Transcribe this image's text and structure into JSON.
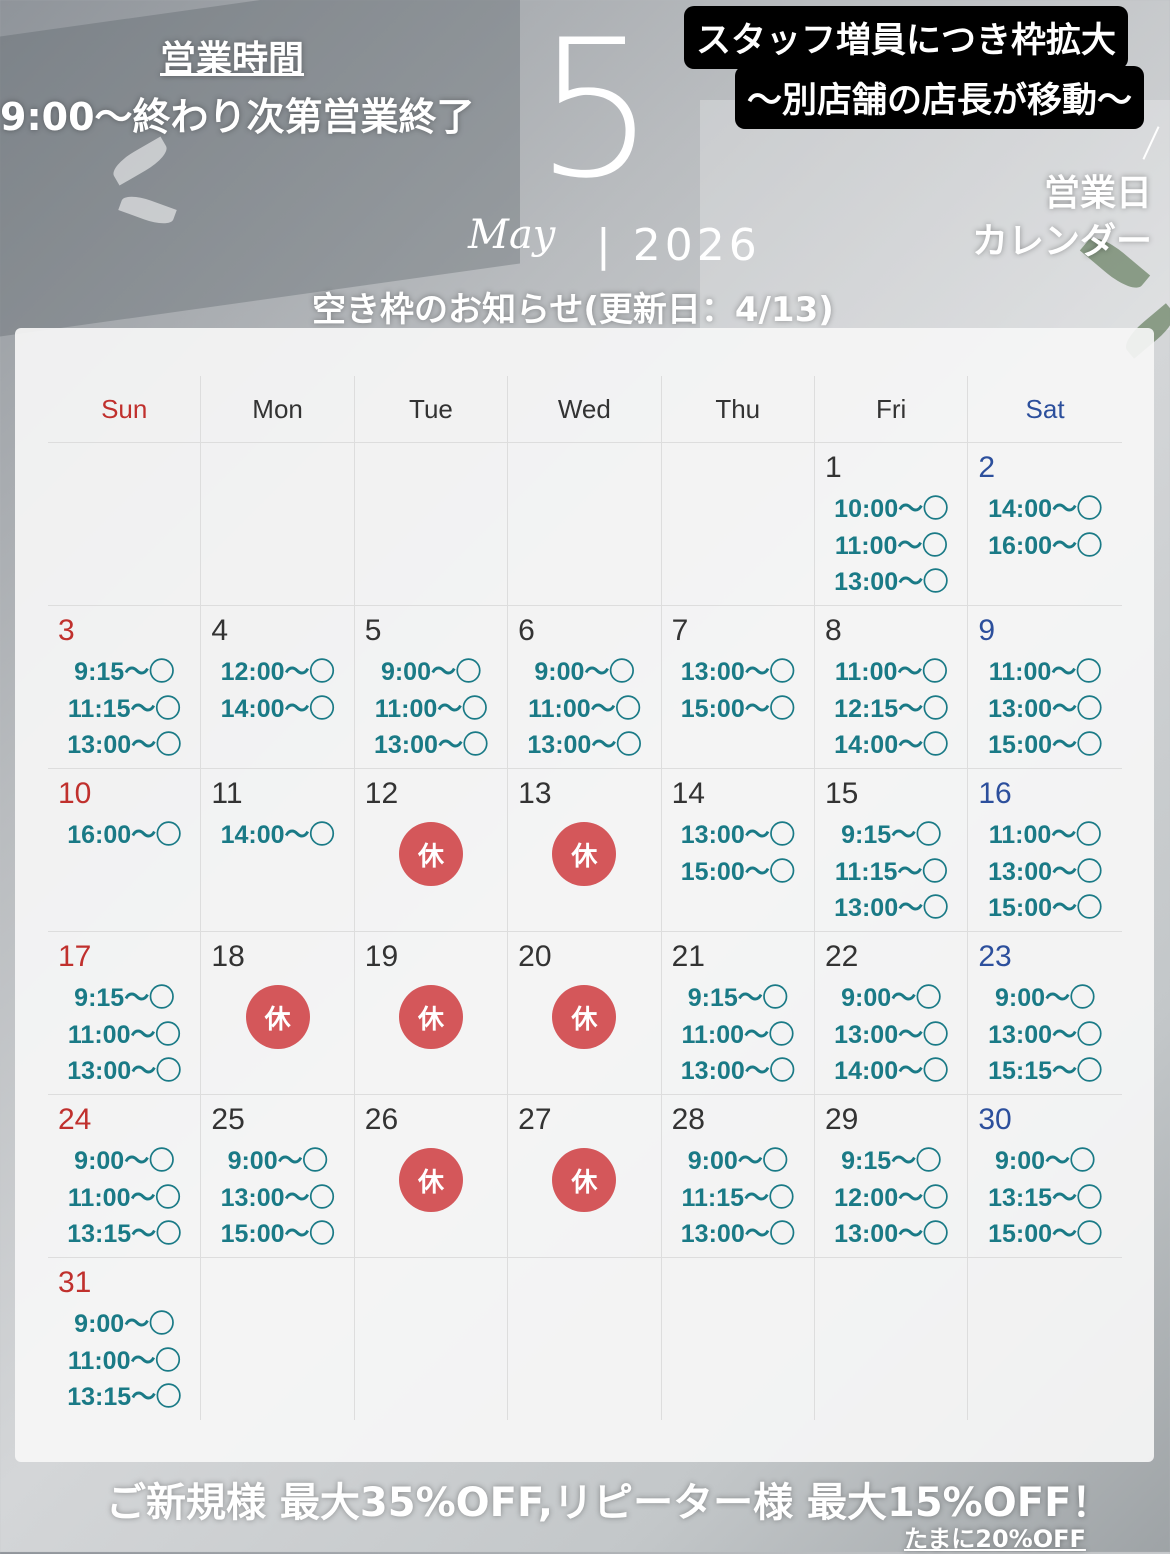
{
  "header": {
    "hours_title": "営業時間",
    "hours_text": "9:00〜終わり次第営業終了",
    "month_number": "5",
    "month_script": "May",
    "year": "| 2026",
    "notice_title": "空き枠のお知らせ(更新日：4/13)",
    "banner_line1": "スタッフ増員につき枠拡大",
    "banner_line2": "〜別店舗の店長が移動〜",
    "calendar_label_line1": "営業日",
    "calendar_label_line2": "カレンダー"
  },
  "calendar": {
    "weekdays": [
      "Sun",
      "Mon",
      "Tue",
      "Wed",
      "Thu",
      "Fri",
      "Sat"
    ],
    "holiday_label": "休",
    "weeks": [
      [
        {
          "day": "",
          "slots": []
        },
        {
          "day": "",
          "slots": []
        },
        {
          "day": "",
          "slots": []
        },
        {
          "day": "",
          "slots": []
        },
        {
          "day": "",
          "slots": []
        },
        {
          "day": "1",
          "slots": [
            "10:00〜◯",
            "11:00〜◯",
            "13:00〜◯"
          ]
        },
        {
          "day": "2",
          "slots": [
            "14:00〜◯",
            "16:00〜◯"
          ]
        }
      ],
      [
        {
          "day": "3",
          "slots": [
            "9:15〜◯",
            "11:15〜◯",
            "13:00〜◯"
          ]
        },
        {
          "day": "4",
          "slots": [
            "12:00〜◯",
            "14:00〜◯"
          ]
        },
        {
          "day": "5",
          "slots": [
            "9:00〜◯",
            "11:00〜◯",
            "13:00〜◯"
          ]
        },
        {
          "day": "6",
          "slots": [
            "9:00〜◯",
            "11:00〜◯",
            "13:00〜◯"
          ]
        },
        {
          "day": "7",
          "slots": [
            "13:00〜◯",
            "15:00〜◯"
          ]
        },
        {
          "day": "8",
          "slots": [
            "11:00〜◯",
            "12:15〜◯",
            "14:00〜◯"
          ]
        },
        {
          "day": "9",
          "slots": [
            "11:00〜◯",
            "13:00〜◯",
            "15:00〜◯"
          ]
        }
      ],
      [
        {
          "day": "10",
          "slots": [
            "16:00〜◯"
          ]
        },
        {
          "day": "11",
          "slots": [
            "14:00〜◯"
          ]
        },
        {
          "day": "12",
          "holiday": true,
          "slots": []
        },
        {
          "day": "13",
          "holiday": true,
          "slots": []
        },
        {
          "day": "14",
          "slots": [
            "13:00〜◯",
            "15:00〜◯"
          ]
        },
        {
          "day": "15",
          "slots": [
            "9:15〜◯",
            "11:15〜◯",
            "13:00〜◯"
          ]
        },
        {
          "day": "16",
          "slots": [
            "11:00〜◯",
            "13:00〜◯",
            "15:00〜◯"
          ]
        }
      ],
      [
        {
          "day": "17",
          "slots": [
            "9:15〜◯",
            "11:00〜◯",
            "13:00〜◯"
          ]
        },
        {
          "day": "18",
          "holiday": true,
          "slots": []
        },
        {
          "day": "19",
          "holiday": true,
          "slots": []
        },
        {
          "day": "20",
          "holiday": true,
          "slots": []
        },
        {
          "day": "21",
          "slots": [
            "9:15〜◯",
            "11:00〜◯",
            "13:00〜◯"
          ]
        },
        {
          "day": "22",
          "slots": [
            "9:00〜◯",
            "13:00〜◯",
            "14:00〜◯"
          ]
        },
        {
          "day": "23",
          "slots": [
            "9:00〜◯",
            "13:00〜◯",
            "15:15〜◯"
          ]
        }
      ],
      [
        {
          "day": "24",
          "slots": [
            "9:00〜◯",
            "11:00〜◯",
            "13:15〜◯"
          ]
        },
        {
          "day": "25",
          "slots": [
            "9:00〜◯",
            "13:00〜◯",
            "15:00〜◯"
          ]
        },
        {
          "day": "26",
          "holiday": true,
          "slots": []
        },
        {
          "day": "27",
          "holiday": true,
          "slots": []
        },
        {
          "day": "28",
          "slots": [
            "9:00〜◯",
            "11:15〜◯",
            "13:00〜◯"
          ]
        },
        {
          "day": "29",
          "slots": [
            "9:15〜◯",
            "12:00〜◯",
            "13:00〜◯"
          ]
        },
        {
          "day": "30",
          "slots": [
            "9:00〜◯",
            "13:15〜◯",
            "15:00〜◯"
          ]
        }
      ],
      [
        {
          "day": "31",
          "slots": [
            "9:00〜◯",
            "11:00〜◯",
            "13:15〜◯"
          ]
        },
        {
          "day": "",
          "slots": []
        },
        {
          "day": "",
          "slots": []
        },
        {
          "day": "",
          "slots": []
        },
        {
          "day": "",
          "slots": []
        },
        {
          "day": "",
          "slots": []
        },
        {
          "day": "",
          "slots": []
        }
      ]
    ]
  },
  "footer": {
    "promo": "ご新規様 最大35%OFF,リピーター様 最大15%OFF！",
    "promo_sub": "たまに20%OFF"
  },
  "colors": {
    "sunday": "#c0302d",
    "saturday": "#2c4f9c",
    "slot_text": "#1a7a86",
    "holiday_badge": "#d4575a"
  }
}
